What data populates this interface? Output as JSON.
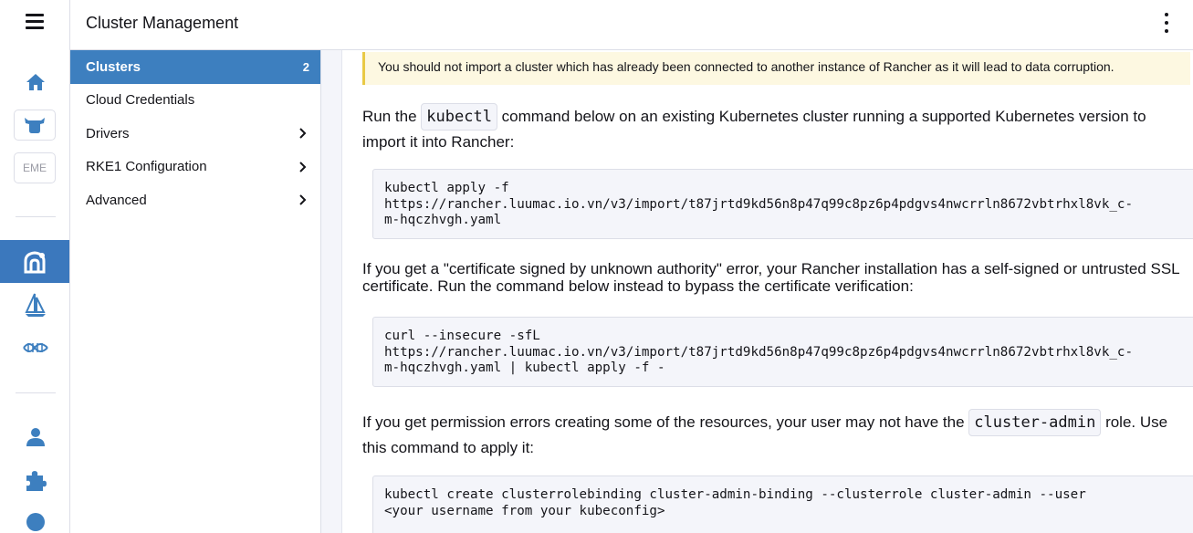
{
  "header": {
    "title": "Cluster Management"
  },
  "rail": {
    "cluster_badge_text": "EME"
  },
  "sidenav": {
    "items": [
      {
        "label": "Clusters",
        "count": "2",
        "active": true
      },
      {
        "label": "Cloud Credentials"
      },
      {
        "label": "Drivers",
        "has_children": true
      },
      {
        "label": "RKE1 Configuration",
        "has_children": true
      },
      {
        "label": "Advanced",
        "has_children": true
      }
    ]
  },
  "main": {
    "banner": "You should not import a cluster which has already been connected to another instance of Rancher as it will lead to data corruption.",
    "p1_before": "Run the",
    "p1_code": "kubectl",
    "p1_after": "command below on an existing Kubernetes cluster running a supported Kubernetes version to import it into Rancher:",
    "code1": "kubectl apply -f\nhttps://rancher.luumac.io.vn/v3/import/t87jrtd9kd56n8p47q99c8pz6p4pdgvs4nwcrrln8672vbtrhxl8vk_c-\nm-hqczhvgh.yaml",
    "p2": "If you get a \"certificate signed by unknown authority\" error, your Rancher installation has a self-signed or untrusted SSL certificate. Run the command below instead to bypass the certificate verification:",
    "code2": "curl --insecure -sfL\nhttps://rancher.luumac.io.vn/v3/import/t87jrtd9kd56n8p47q99c8pz6p4pdgvs4nwcrrln8672vbtrhxl8vk_c-\nm-hqczhvgh.yaml | kubectl apply -f -",
    "p3_before": "If you get permission errors creating some of the resources, your user may not have the",
    "p3_code": "cluster-admin",
    "p3_after": "role. Use this command to apply it:",
    "code3": "kubectl create clusterrolebinding cluster-admin-binding --clusterrole cluster-admin --user\n<your username from your kubeconfig>"
  },
  "colors": {
    "accent": "#3d7fbf",
    "rail_active": "#3b78bd",
    "banner_bg": "#fdf8e1",
    "banner_border": "#e9c945",
    "icon_blue": "#3d7fbf"
  },
  "icons": [
    "menu-icon",
    "home-icon",
    "longhorn-cluster-icon",
    "cluster-explorer-icon",
    "fleet-icon",
    "multicluster-apps-icon",
    "users-icon",
    "extensions-icon",
    "globe-icon",
    "more-vertical-icon",
    "chevron-right-icon"
  ]
}
